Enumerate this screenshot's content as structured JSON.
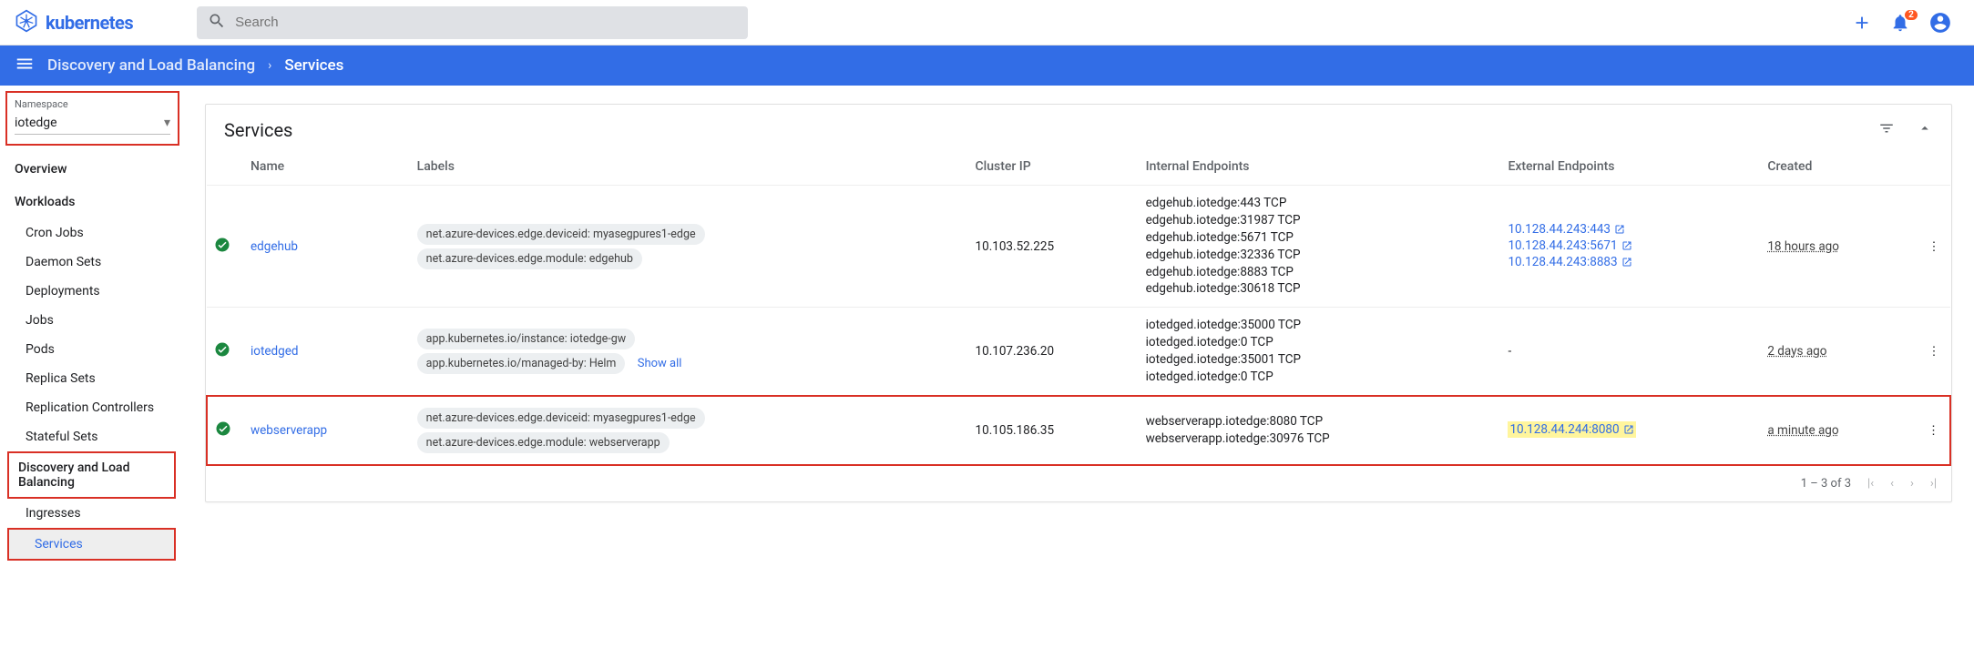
{
  "header": {
    "brand": "kubernetes",
    "search_placeholder": "Search",
    "notification_count": "2"
  },
  "breadcrumb": {
    "parent": "Discovery and Load Balancing",
    "current": "Services"
  },
  "namespace": {
    "label": "Namespace",
    "value": "iotedge"
  },
  "sidebar": {
    "overview": "Overview",
    "workloads": {
      "heading": "Workloads",
      "items": [
        "Cron Jobs",
        "Daemon Sets",
        "Deployments",
        "Jobs",
        "Pods",
        "Replica Sets",
        "Replication Controllers",
        "Stateful Sets"
      ]
    },
    "dlb": {
      "heading": "Discovery and Load Balancing",
      "items": [
        "Ingresses",
        "Services"
      ]
    }
  },
  "services": {
    "title": "Services",
    "columns": {
      "name": "Name",
      "labels": "Labels",
      "cluster_ip": "Cluster IP",
      "internal": "Internal Endpoints",
      "external": "External Endpoints",
      "created": "Created"
    },
    "rows": [
      {
        "name": "edgehub",
        "labels": [
          "net.azure-devices.edge.deviceid: myasegpures1-edge",
          "net.azure-devices.edge.module: edgehub"
        ],
        "cluster_ip": "10.103.52.225",
        "internal": [
          "edgehub.iotedge:443 TCP",
          "edgehub.iotedge:31987 TCP",
          "edgehub.iotedge:5671 TCP",
          "edgehub.iotedge:32336 TCP",
          "edgehub.iotedge:8883 TCP",
          "edgehub.iotedge:30618 TCP"
        ],
        "external": [
          "10.128.44.243:443",
          "10.128.44.243:5671",
          "10.128.44.243:8883"
        ],
        "created": "18 hours ago"
      },
      {
        "name": "iotedged",
        "labels": [
          "app.kubernetes.io/instance: iotedge-gw",
          "app.kubernetes.io/managed-by: Helm"
        ],
        "show_all": "Show all",
        "cluster_ip": "10.107.236.20",
        "internal": [
          "iotedged.iotedge:35000 TCP",
          "iotedged.iotedge:0 TCP",
          "iotedged.iotedge:35001 TCP",
          "iotedged.iotedge:0 TCP"
        ],
        "external_placeholder": "-",
        "created": "2 days ago"
      },
      {
        "name": "webserverapp",
        "labels": [
          "net.azure-devices.edge.deviceid: myasegpures1-edge",
          "net.azure-devices.edge.module: webserverapp"
        ],
        "cluster_ip": "10.105.186.35",
        "internal": [
          "webserverapp.iotedge:8080 TCP",
          "webserverapp.iotedge:30976 TCP"
        ],
        "external": [
          "10.128.44.244:8080"
        ],
        "created": "a minute ago"
      }
    ],
    "pagination": "1 – 3 of 3"
  }
}
